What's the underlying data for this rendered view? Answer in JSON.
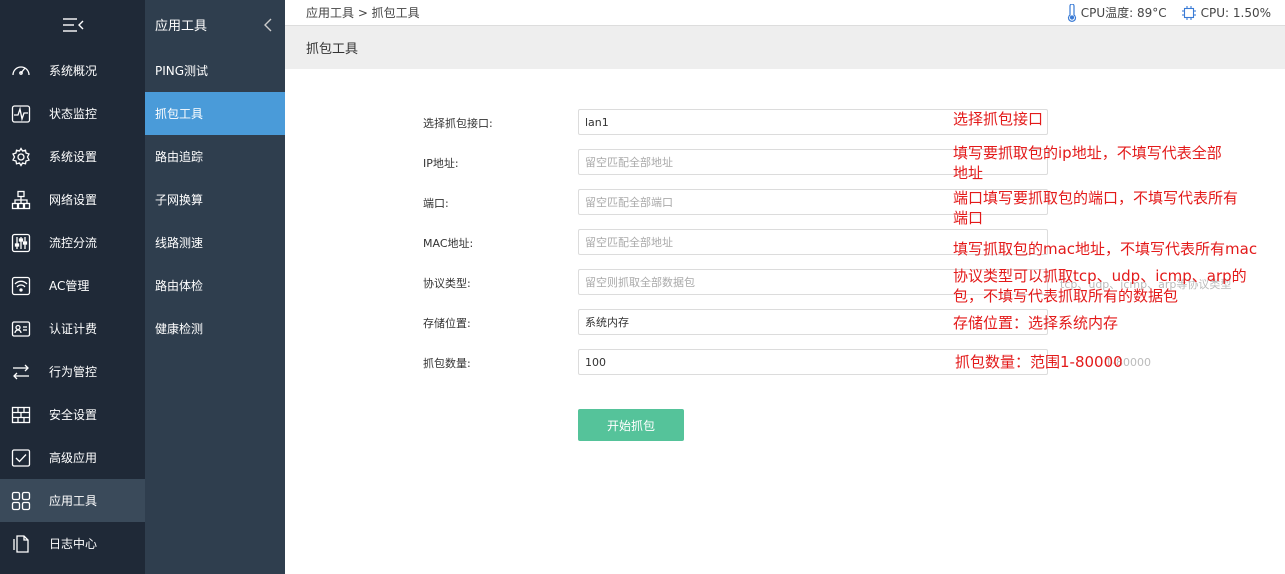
{
  "sidebar": {
    "items": [
      {
        "label": "系统概况",
        "icon": "dashboard-icon"
      },
      {
        "label": "状态监控",
        "icon": "pulse-icon"
      },
      {
        "label": "系统设置",
        "icon": "gear-icon"
      },
      {
        "label": "网络设置",
        "icon": "network-icon"
      },
      {
        "label": "流控分流",
        "icon": "sliders-icon"
      },
      {
        "label": "AC管理",
        "icon": "wifi-icon"
      },
      {
        "label": "认证计费",
        "icon": "id-card-icon"
      },
      {
        "label": "行为管控",
        "icon": "arrows-icon"
      },
      {
        "label": "安全设置",
        "icon": "firewall-icon"
      },
      {
        "label": "高级应用",
        "icon": "checklist-icon"
      },
      {
        "label": "应用工具",
        "icon": "apps-icon"
      },
      {
        "label": "日志中心",
        "icon": "document-icon"
      }
    ]
  },
  "subnav": {
    "title": "应用工具",
    "items": [
      "PING测试",
      "抓包工具",
      "路由追踪",
      "子网换算",
      "线路测速",
      "路由体检",
      "健康检测"
    ]
  },
  "topbar": {
    "breadcrumb": "应用工具 > 抓包工具",
    "cpu_temp": "CPU温度: 89°C",
    "cpu_usage": "CPU: 1.50%"
  },
  "page": {
    "title": "抓包工具"
  },
  "form": {
    "interface": {
      "label": "选择抓包接口:",
      "value": "lan1",
      "note": "选择抓包接口"
    },
    "ip": {
      "label": "IP地址:",
      "placeholder": "留空匹配全部地址",
      "note": "填写要抓取包的ip地址，不填写代表全部\n地址"
    },
    "port": {
      "label": "端口:",
      "placeholder": "留空匹配全部端口",
      "note": "端口填写要抓取包的端口，不填写代表所有\n端口"
    },
    "mac": {
      "label": "MAC地址:",
      "placeholder": "留空匹配全部地址",
      "note": "填写抓取包的mac地址，不填写代表所有mac"
    },
    "protocol": {
      "label": "协议类型:",
      "placeholder": "留空则抓取全部数据包",
      "note": "协议类型可以抓取tcp、udp、icmp、arp的\n包，不填写代表抓取所有的数据包",
      "ghost": "tcp、udp、icmp、arp等协议类型"
    },
    "storage": {
      "label": "存储位置:",
      "value": "系统内存",
      "note": "存储位置：选择系统内存"
    },
    "count": {
      "label": "抓包数量:",
      "value": "100",
      "note": "抓包数量：范围1-80000",
      "ghost": "1-80000"
    },
    "submit": "开始抓包"
  },
  "colors": {
    "sidebar_bg": "#1f2937",
    "subnav_bg": "#2f3e4e",
    "subnav_active": "#4a9bd9",
    "button": "#55c39a",
    "annotation": "#e31a1a"
  }
}
